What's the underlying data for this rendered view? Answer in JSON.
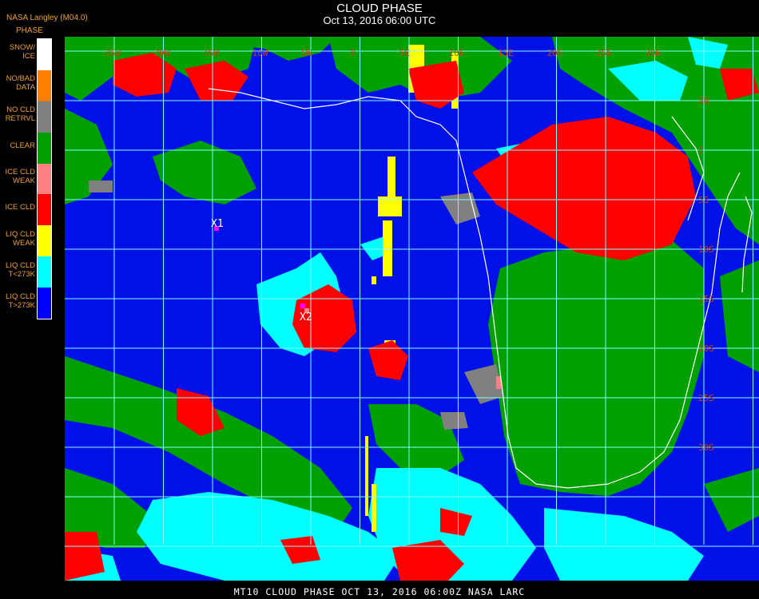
{
  "header": {
    "title": "CLOUD PHASE",
    "subtitle": "Oct 13, 2016 06:00 UTC",
    "credit": "NASA Langley (M04.0)"
  },
  "legend": {
    "title": "PHASE",
    "items": [
      {
        "label": "SNOW/\nICE",
        "color": "#ffffff"
      },
      {
        "label": "NO/BAD\nDATA",
        "color": "#ff8000"
      },
      {
        "label": "NO CLD\nRETRVL",
        "color": "#808080"
      },
      {
        "label": "CLEAR",
        "color": "#00a000"
      },
      {
        "label": "ICE CLD\nWEAK",
        "color": "#ff8080"
      },
      {
        "label": "ICE CLD",
        "color": "#ff0000"
      },
      {
        "label": "LIQ CLD\nWEAK",
        "color": "#ffff00"
      },
      {
        "label": "LIQ CLD\nT<273K",
        "color": "#00ffff"
      },
      {
        "label": "LIQ CLD\nT>273K",
        "color": "#0000ff"
      }
    ]
  },
  "markers": [
    {
      "label": "X1"
    },
    {
      "label": "X2"
    }
  ],
  "grid_labels": {
    "longitude": [
      "25W",
      "20W",
      "15W",
      "10W",
      "5W",
      "0",
      "5E",
      "10E",
      "15E",
      "20E",
      "25E",
      "30E"
    ],
    "latitude": [
      "5N",
      "0",
      "5S",
      "10S",
      "15S",
      "20S",
      "25S",
      "30S"
    ]
  },
  "colors": {
    "grid": "#80ffff",
    "coastline": "#ffffff",
    "credit_text": "#f0a030",
    "coord_text": "#c84020"
  },
  "footer": {
    "text": "MT10  CLOUD PHASE   OCT 13, 2016 06:00Z   NASA LARC"
  }
}
